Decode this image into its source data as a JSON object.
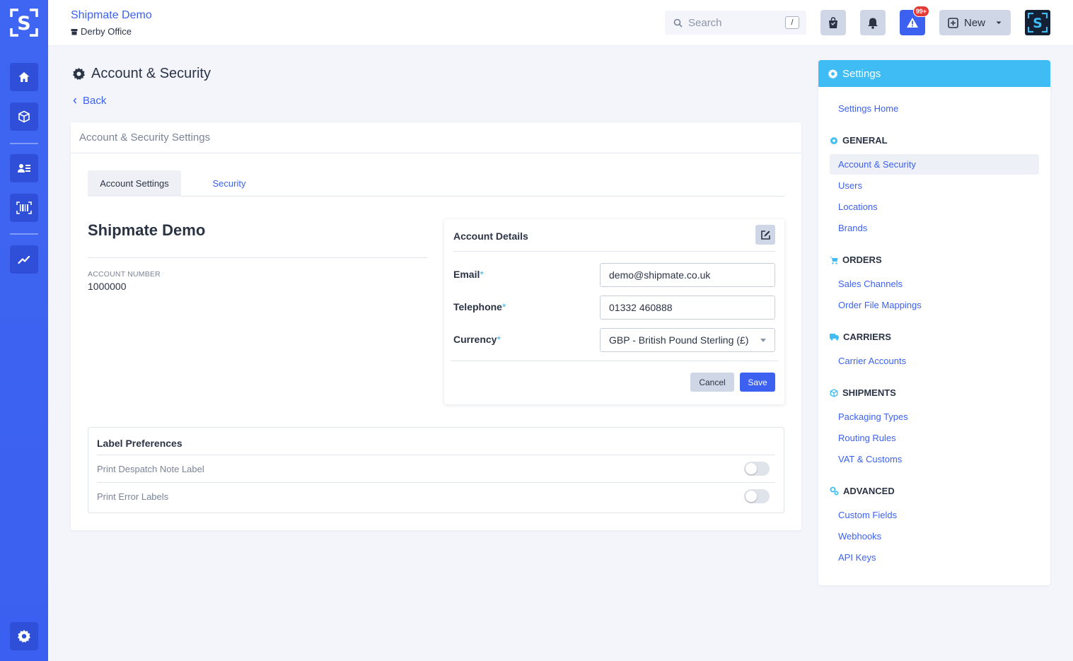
{
  "app": {
    "org_name": "Shipmate Demo",
    "office": "Derby Office"
  },
  "topbar": {
    "search_placeholder": "Search",
    "search_shortcut": "/",
    "alert_badge": "99+",
    "new_label": "New"
  },
  "page": {
    "title": "Account & Security",
    "back_label": "Back",
    "card_title": "Account & Security Settings",
    "tabs": [
      {
        "label": "Account Settings",
        "active": true
      },
      {
        "label": "Security",
        "active": false
      }
    ]
  },
  "account": {
    "name": "Shipmate Demo",
    "number_label": "Account Number",
    "number": "1000000"
  },
  "details": {
    "title": "Account Details",
    "fields": {
      "email": {
        "label": "Email",
        "required_mark": "*",
        "value": "demo@shipmate.co.uk"
      },
      "telephone": {
        "label": "Telephone",
        "required_mark": "*",
        "value": "01332 460888"
      },
      "currency": {
        "label": "Currency",
        "required_mark": "*",
        "value": "GBP - British Pound Sterling (£)"
      }
    },
    "cancel_label": "Cancel",
    "save_label": "Save"
  },
  "label_prefs": {
    "title": "Label Preferences",
    "items": [
      {
        "label": "Print Despatch Note Label",
        "enabled": false
      },
      {
        "label": "Print Error Labels",
        "enabled": false
      }
    ]
  },
  "settings_nav": {
    "title": "Settings",
    "home": "Settings Home",
    "sections": [
      {
        "title": "General",
        "icon": "gear-icon",
        "items": [
          "Account & Security",
          "Users",
          "Locations",
          "Brands"
        ]
      },
      {
        "title": "Orders",
        "icon": "cart-icon",
        "items": [
          "Sales Channels",
          "Order File Mappings"
        ]
      },
      {
        "title": "Carriers",
        "icon": "truck-icon",
        "items": [
          "Carrier Accounts"
        ]
      },
      {
        "title": "Shipments",
        "icon": "box-icon",
        "items": [
          "Packaging Types",
          "Routing Rules",
          "VAT & Customs"
        ]
      },
      {
        "title": "Advanced",
        "icon": "cogs-icon",
        "items": [
          "Custom Fields",
          "Webhooks",
          "API Keys"
        ]
      }
    ],
    "active_item": "Account & Security"
  },
  "colors": {
    "brand": "#3c61f0",
    "rail": "#3f66f2",
    "settings_header": "#3ebcf3",
    "required": "#3fb3e5",
    "badge": "#e53935"
  }
}
